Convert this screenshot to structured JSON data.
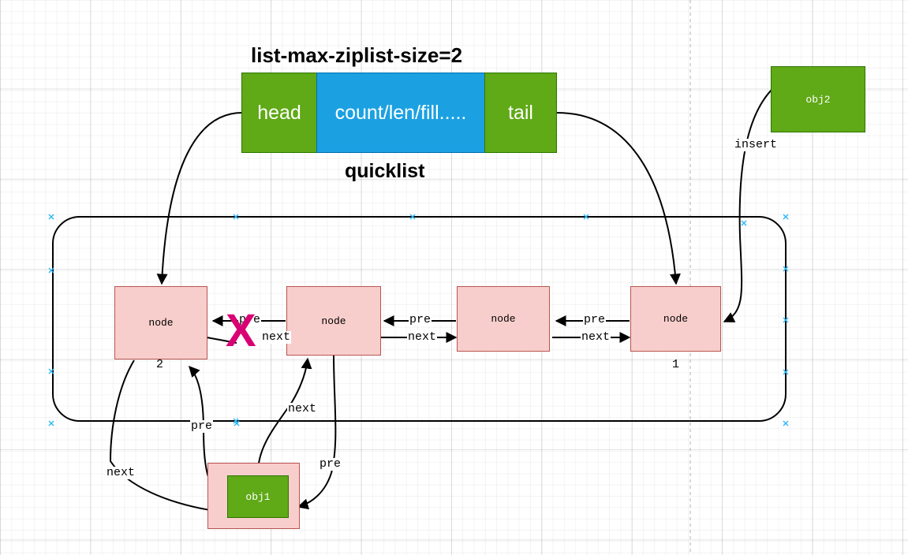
{
  "diagram": {
    "title": "list-max-ziplist-size=2",
    "subtitle": "quicklist",
    "page_break": true
  },
  "quicklist": {
    "head_label": "head",
    "body_label": "count/len/fill.....",
    "tail_label": "tail"
  },
  "objects": {
    "obj2": "obj2",
    "obj1": "obj1",
    "insert_label": "insert"
  },
  "nodes": [
    {
      "label": "node",
      "badge": "2"
    },
    {
      "label": "node",
      "badge": ""
    },
    {
      "label": "node",
      "badge": ""
    },
    {
      "label": "node",
      "badge": "1"
    }
  ],
  "edge_labels": {
    "pre": "pre",
    "next": "next",
    "n1_n2_pre": "pre",
    "n1_n2_next": "next",
    "n2_n3_pre": "pre",
    "n2_n3_next": "next",
    "n3_n4_pre": "pre",
    "n3_n4_next": "next",
    "obj1_next_out": "next",
    "obj1_pre_out": "pre",
    "obj1_next_in": "next",
    "obj1_pre_in": "pre"
  },
  "annotations": {
    "broken_link": "X"
  },
  "colors": {
    "green": "#60a917",
    "blue": "#1ba1e2",
    "pink": "#f8cecc",
    "pink_border": "#b85450",
    "magenta": "#d80073",
    "stroke": "#000000",
    "anchor": "#29b6f6"
  }
}
